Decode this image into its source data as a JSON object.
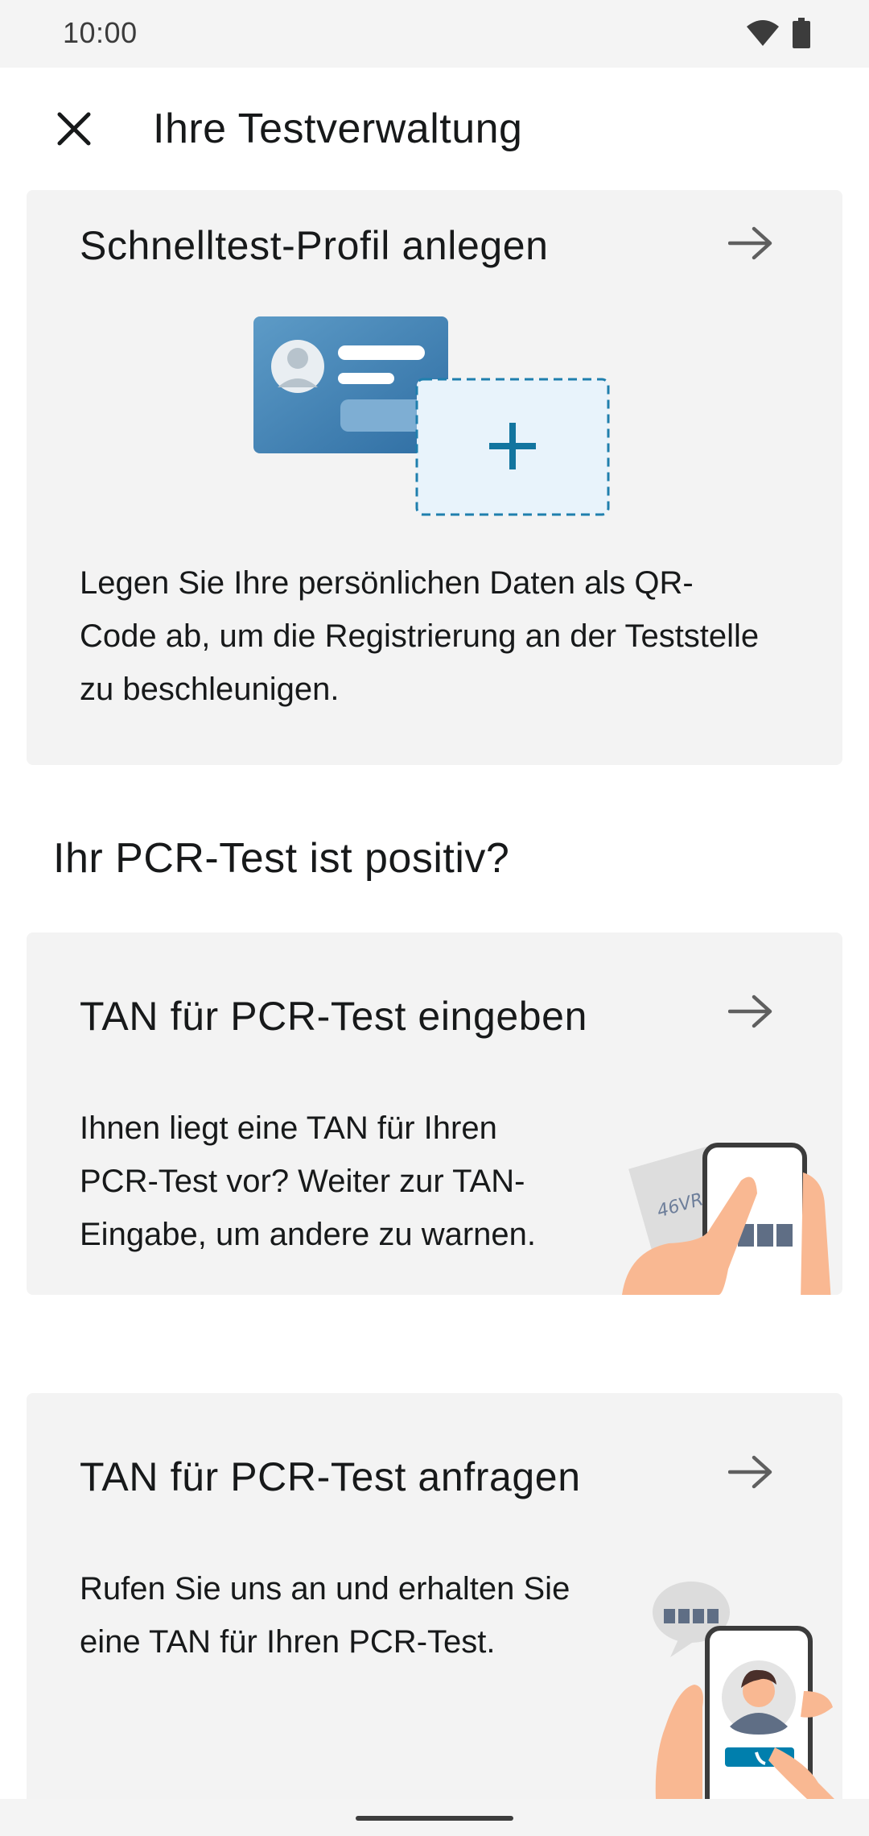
{
  "status_bar": {
    "time": "10:00"
  },
  "app_bar": {
    "title": "Ihre Testverwaltung"
  },
  "profile_card": {
    "title": "Schnelltest-Profil anlegen",
    "body": "Legen Sie Ihre persönlichen Daten als QR-Code ab, um die Registrierung an der Teststelle zu beschleunigen."
  },
  "pcr_section": {
    "title": "Ihr PCR-Test ist positiv?"
  },
  "tan_enter_card": {
    "title": "TAN für PCR-Test eingeben",
    "body": "Ihnen liegt eine TAN für Ihren PCR-Test vor? Weiter zur TAN-Eingabe, um andere zu warnen.",
    "illustration_code": "46VRF8"
  },
  "tan_request_card": {
    "title": "TAN für PCR-Test anfragen",
    "body": "Rufen Sie uns an und erhalten Sie eine TAN für Ihren PCR-Test."
  },
  "colors": {
    "accent": "#007fad",
    "card_background": "#f3f3f3",
    "text": "#17191a",
    "skin": "#f9b892"
  }
}
